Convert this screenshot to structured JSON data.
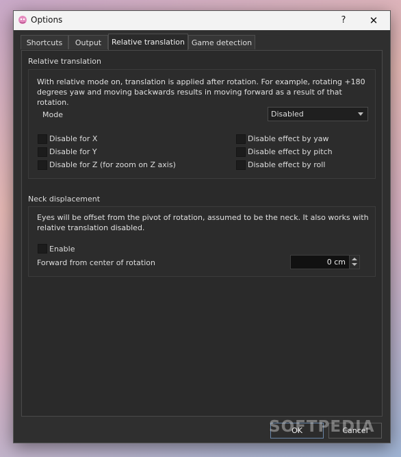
{
  "window": {
    "title": "Options",
    "help_label": "?",
    "close_label": "✕"
  },
  "tabs": [
    {
      "label": "Shortcuts"
    },
    {
      "label": "Output"
    },
    {
      "label": "Relative translation"
    },
    {
      "label": "Game detection"
    }
  ],
  "relative_translation": {
    "section_title": "Relative translation",
    "description": "With relative mode on, translation is applied after rotation. For example, rotating +180 degrees yaw and moving backwards results in moving forward as a result of that rotation.",
    "mode_label": "Mode",
    "mode_value": "Disabled",
    "checkboxes_left": [
      {
        "label": "Disable for X"
      },
      {
        "label": "Disable for Y"
      },
      {
        "label": "Disable for Z (for zoom on Z axis)"
      }
    ],
    "checkboxes_right": [
      {
        "label": "Disable effect by yaw"
      },
      {
        "label": "Disable effect by pitch"
      },
      {
        "label": "Disable effect by roll"
      }
    ]
  },
  "neck_displacement": {
    "section_title": "Neck displacement",
    "description": "Eyes will be offset from the pivot of rotation, assumed to be the neck. It also works with relative translation disabled.",
    "enable_label": "Enable",
    "forward_label": "Forward from center of rotation",
    "forward_value": "0 cm"
  },
  "buttons": {
    "ok": "OK",
    "cancel": "Cancel"
  },
  "watermark": "SOFTPEDIA"
}
